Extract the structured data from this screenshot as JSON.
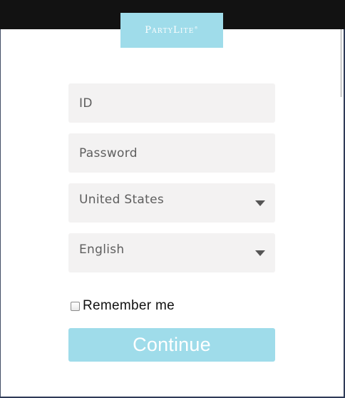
{
  "brand": {
    "logo_text": "PartyLite",
    "logo_mark": "®",
    "accent_color": "#9fdcea"
  },
  "form": {
    "id_placeholder": "ID",
    "password_placeholder": "Password",
    "country_selected": "United States",
    "language_selected": "English",
    "remember_label": "Remember me",
    "remember_checked": false,
    "continue_label": "Continue"
  },
  "icons": {
    "dropdown": "chevron-down-icon",
    "checkbox": "checkbox-unchecked"
  }
}
